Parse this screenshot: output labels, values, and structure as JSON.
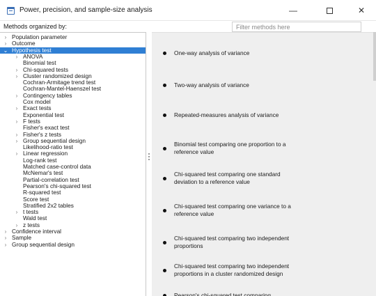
{
  "window": {
    "title": "Power, precision, and sample-size analysis",
    "minimize_glyph": "—",
    "close_glyph": "✕"
  },
  "sidebar": {
    "header": "Methods organized by:",
    "tree": [
      {
        "label": "Population parameter",
        "level": 0,
        "expander": "collapsed"
      },
      {
        "label": "Outcome",
        "level": 0,
        "expander": "collapsed"
      },
      {
        "label": "Hypothesis test",
        "level": 0,
        "expander": "expanded",
        "selected": true
      },
      {
        "label": "ANOVA",
        "level": 1,
        "expander": "collapsed"
      },
      {
        "label": "Binomial test",
        "level": 1,
        "expander": "none"
      },
      {
        "label": "Chi-squared tests",
        "level": 1,
        "expander": "collapsed"
      },
      {
        "label": "Cluster randomized design",
        "level": 1,
        "expander": "collapsed"
      },
      {
        "label": "Cochran-Armitage trend test",
        "level": 1,
        "expander": "none"
      },
      {
        "label": "Cochran-Mantel-Haenszel test",
        "level": 1,
        "expander": "none"
      },
      {
        "label": "Contingency tables",
        "level": 1,
        "expander": "collapsed"
      },
      {
        "label": "Cox model",
        "level": 1,
        "expander": "none"
      },
      {
        "label": "Exact tests",
        "level": 1,
        "expander": "collapsed"
      },
      {
        "label": "Exponential test",
        "level": 1,
        "expander": "none"
      },
      {
        "label": "F tests",
        "level": 1,
        "expander": "collapsed"
      },
      {
        "label": "Fisher's exact test",
        "level": 1,
        "expander": "none"
      },
      {
        "label": "Fisher's z tests",
        "level": 1,
        "expander": "collapsed"
      },
      {
        "label": "Group sequential design",
        "level": 1,
        "expander": "collapsed"
      },
      {
        "label": "Likelihood-ratio test",
        "level": 1,
        "expander": "none"
      },
      {
        "label": "Linear regression",
        "level": 1,
        "expander": "collapsed"
      },
      {
        "label": "Log-rank test",
        "level": 1,
        "expander": "none"
      },
      {
        "label": "Matched case-control data",
        "level": 1,
        "expander": "none"
      },
      {
        "label": "McNemar's test",
        "level": 1,
        "expander": "none"
      },
      {
        "label": "Partial-correlation test",
        "level": 1,
        "expander": "none"
      },
      {
        "label": "Pearson's chi-squared test",
        "level": 1,
        "expander": "none"
      },
      {
        "label": "R-squared test",
        "level": 1,
        "expander": "none"
      },
      {
        "label": "Score test",
        "level": 1,
        "expander": "none"
      },
      {
        "label": "Stratified 2x2 tables",
        "level": 1,
        "expander": "none"
      },
      {
        "label": "t tests",
        "level": 1,
        "expander": "collapsed"
      },
      {
        "label": "Wald test",
        "level": 1,
        "expander": "none"
      },
      {
        "label": "z tests",
        "level": 1,
        "expander": "collapsed"
      },
      {
        "label": "Confidence interval",
        "level": 0,
        "expander": "collapsed"
      },
      {
        "label": "Sample",
        "level": 0,
        "expander": "collapsed"
      },
      {
        "label": "Group sequential design",
        "level": 0,
        "expander": "collapsed"
      }
    ]
  },
  "search": {
    "placeholder": "Filter methods here",
    "value": ""
  },
  "methods": [
    "One-way analysis of variance",
    "Two-way analysis of variance",
    "Repeated-measures analysis of variance",
    "Binomial test comparing one proportion to a reference value",
    "Chi-squared test comparing one standard deviation to a reference value",
    "Chi-squared test comparing one variance to a reference value",
    "Chi-squared test comparing two independent proportions",
    "Chi-squared test comparing two independent proportions in a cluster randomized design",
    "Pearson's chi-squared test comparing"
  ],
  "icons": {
    "expanded": "chevron-down-icon",
    "collapsed": "chevron-right-icon",
    "app": "window-app-icon"
  },
  "colors": {
    "selection": "#2f7fd4",
    "content_background": "#efefef"
  }
}
